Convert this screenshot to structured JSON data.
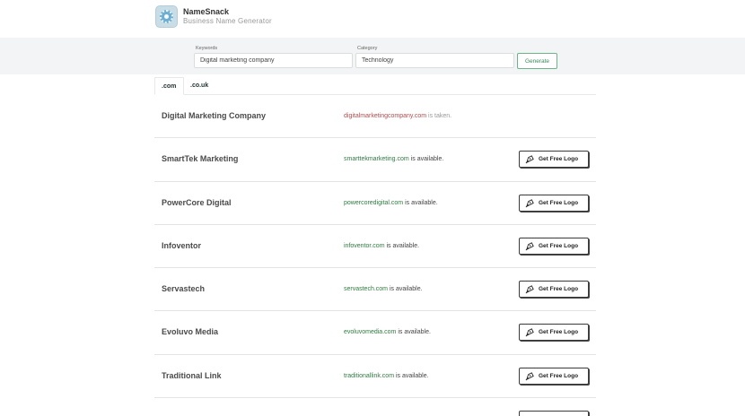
{
  "app": {
    "name": "NameSnack",
    "subtitle": "Business Name Generator"
  },
  "search": {
    "keywords_label": "Keywords",
    "keywords_value": "Digital marketing company",
    "category_label": "Category",
    "category_value": "Technology",
    "generate_label": "Generate"
  },
  "tabs": [
    ".com",
    ".co.uk"
  ],
  "logo_button_label": "Get Free Logo",
  "results": [
    {
      "name": "Digital Marketing Company",
      "domain": "digitalmarketingcompany.com",
      "status": "is taken.",
      "available": false
    },
    {
      "name": "SmartTek Marketing",
      "domain": "smarttekmarketing.com",
      "status": "is available.",
      "available": true
    },
    {
      "name": "PowerCore Digital",
      "domain": "powercoredigital.com",
      "status": "is available.",
      "available": true
    },
    {
      "name": "Infoventor",
      "domain": "infoventor.com",
      "status": "is available.",
      "available": true
    },
    {
      "name": "Servastech",
      "domain": "servastech.com",
      "status": "is available.",
      "available": true
    },
    {
      "name": "Evoluvo Media",
      "domain": "evoluvomedia.com",
      "status": "is available.",
      "available": true
    },
    {
      "name": "Traditional Link",
      "domain": "traditionallink.com",
      "status": "is available.",
      "available": true
    }
  ],
  "colors": {
    "available": "#2f7a3f",
    "taken": "#b34a4a",
    "generate_border": "#6cb389"
  }
}
